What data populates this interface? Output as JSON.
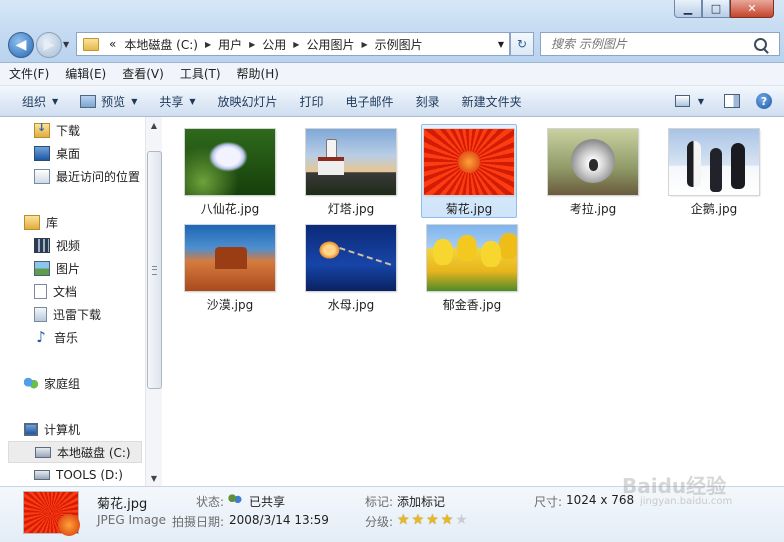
{
  "window": {
    "controls": {
      "minimize": "▁",
      "maximize": "□",
      "close": "✕"
    }
  },
  "navigation": {
    "back_icon": "◀",
    "forward_icon": "▶",
    "recent_dropdown_icon": "▼",
    "address_overflow": "«",
    "address_parts": [
      "本地磁盘 (C:)",
      "用户",
      "公用",
      "公用图片",
      "示例图片"
    ],
    "address_separator": "▶",
    "address_dropdown_icon": "▼",
    "refresh_icon": "↻",
    "search_placeholder": "搜索 示例图片"
  },
  "menubar": [
    "文件(F)",
    "编辑(E)",
    "查看(V)",
    "工具(T)",
    "帮助(H)"
  ],
  "commandbar": {
    "organize": "组织",
    "preview": "预览",
    "share": "共享",
    "slideshow": "放映幻灯片",
    "print": "打印",
    "email": "电子邮件",
    "burn": "刻录",
    "new_folder": "新建文件夹",
    "dropdown_arrow": "▼",
    "help_icon": "?"
  },
  "sidebar": {
    "favorites": [
      "下载",
      "桌面",
      "最近访问的位置"
    ],
    "library_header": "库",
    "libraries": [
      "视频",
      "图片",
      "文档",
      "迅雷下载",
      "音乐"
    ],
    "homegroup": "家庭组",
    "computer_header": "计算机",
    "drives": [
      "本地磁盘 (C:)",
      "TOOLS (D:)"
    ],
    "selected": "本地磁盘 (C:)",
    "scroll_up": "▲",
    "scroll_down": "▼"
  },
  "files": [
    {
      "name": "八仙花.jpg",
      "thumb": "hydrangea"
    },
    {
      "name": "灯塔.jpg",
      "thumb": "lighthouse"
    },
    {
      "name": "菊花.jpg",
      "thumb": "chrysanthemum"
    },
    {
      "name": "考拉.jpg",
      "thumb": "koala"
    },
    {
      "name": "企鹅.jpg",
      "thumb": "penguins"
    },
    {
      "name": "沙漠.jpg",
      "thumb": "desert"
    },
    {
      "name": "水母.jpg",
      "thumb": "jellyfish"
    },
    {
      "name": "郁金香.jpg",
      "thumb": "tulips"
    }
  ],
  "selected_file_index": 2,
  "details": {
    "name": "菊花.jpg",
    "type": "JPEG Image",
    "status_label": "状态:",
    "status_value": "已共享",
    "date_label": "拍摄日期:",
    "date_value": "2008/3/14 13:59",
    "tags_label": "标记:",
    "tags_value": "添加标记",
    "rating_label": "分级:",
    "rating": 4,
    "rating_max": 5,
    "star_glyph": "★",
    "size_label": "尺寸:",
    "size_value": "1024 x 768"
  },
  "watermark": {
    "logo": "Baidu经验",
    "url": "jingyan.baidu.com"
  },
  "colors": {
    "selection": "#cfe4fa",
    "selection_border": "#8fbce8",
    "star": "#e8b923"
  }
}
